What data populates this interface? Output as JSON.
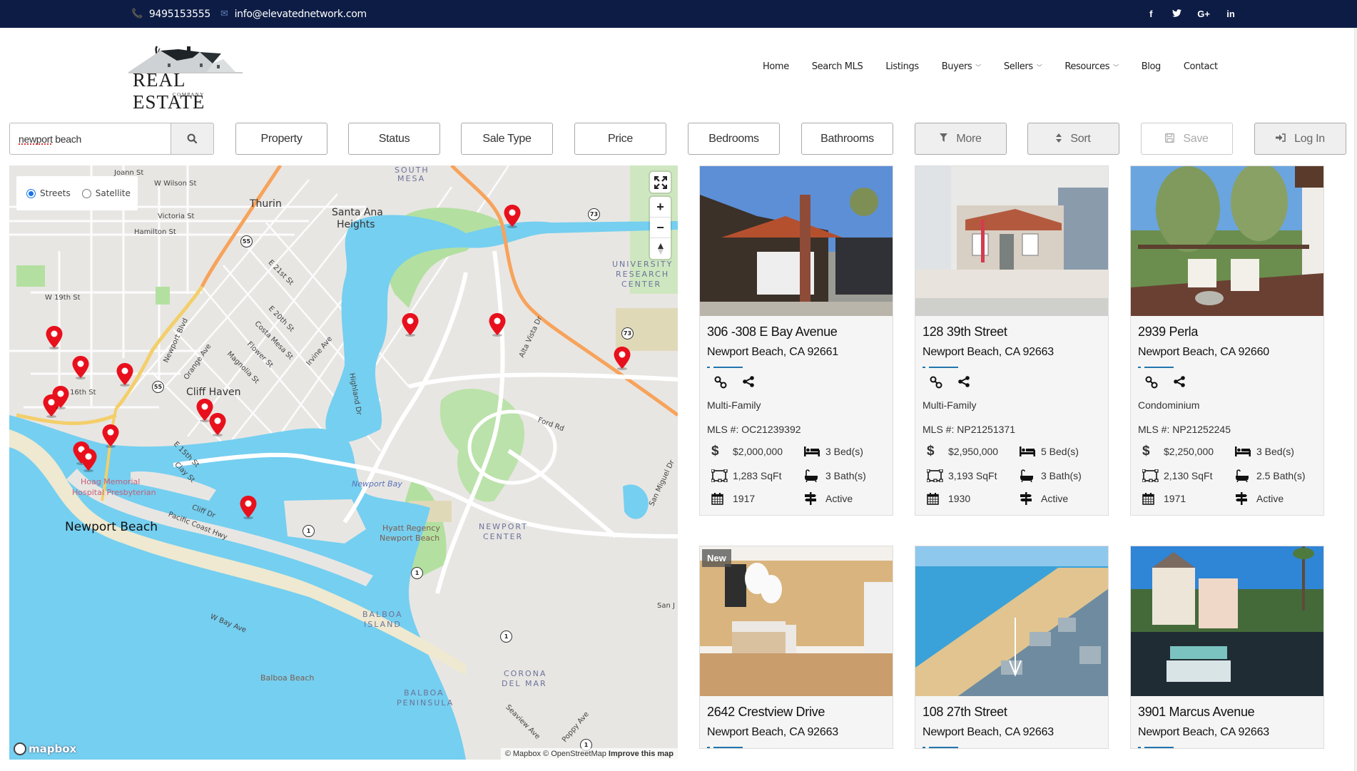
{
  "topbar": {
    "phone": "9495153555",
    "email": "info@elevatednetwork.com",
    "social": [
      {
        "name": "facebook-icon",
        "glyph": "f"
      },
      {
        "name": "twitter-icon",
        "glyph": "🐦"
      },
      {
        "name": "google-plus-icon",
        "glyph": "G+"
      },
      {
        "name": "linkedin-icon",
        "glyph": "in"
      }
    ]
  },
  "logo": {
    "brand": "REAL ESTATE",
    "sub": "COMPANY"
  },
  "nav": {
    "items": [
      {
        "label": "Home",
        "dropdown": false
      },
      {
        "label": "Search MLS",
        "dropdown": false
      },
      {
        "label": "Listings",
        "dropdown": false
      },
      {
        "label": "Buyers",
        "dropdown": true
      },
      {
        "label": "Sellers",
        "dropdown": true
      },
      {
        "label": "Resources",
        "dropdown": true
      },
      {
        "label": "Blog",
        "dropdown": false
      },
      {
        "label": "Contact",
        "dropdown": false
      }
    ]
  },
  "filters": {
    "search_value": "newport beach",
    "buttons": {
      "property": "Property",
      "status": "Status",
      "sale_type": "Sale Type",
      "price": "Price",
      "bedrooms": "Bedrooms",
      "bathrooms": "Bathrooms",
      "more": "More",
      "sort": "Sort",
      "save": "Save",
      "login": "Log In"
    }
  },
  "map": {
    "map_types": [
      {
        "label": "Streets",
        "selected": true
      },
      {
        "label": "Satellite",
        "selected": false
      }
    ],
    "labels": {
      "joann": "Joann St",
      "wilson": "W Wilson St",
      "thurin": "Thurin",
      "victoria": "Victoria St",
      "hamilton": "Hamilton St",
      "santa_ana": "Santa Ana",
      "heights": "Heights",
      "south": "SOUTH",
      "mesa": "MESA",
      "w19": "W 19th St",
      "w16": "W 16th St",
      "cliff_haven": "Cliff Haven",
      "newport_beach": "Newport Beach",
      "hoag1": "Hoag Memorial",
      "hoag2": "Hospital Presbyterian",
      "newport_bay": "Newport Bay",
      "hyatt1": "Hyatt Regency",
      "hyatt2": "Newport Beach",
      "newport_center1": "NEWPORT",
      "newport_center2": "CENTER",
      "univ1": "UNIVERSITY",
      "univ2": "RESEARCH",
      "univ3": "CENTER",
      "balboa_island1": "BALBOA",
      "balboa_island2": "ISLAND",
      "balboa_pen1": "BALBOA",
      "balboa_pen2": "PENINSULA",
      "corona1": "CORONA",
      "corona2": "DEL MAR",
      "balboa_beach": "Balboa Beach",
      "ford_rd": "Ford Rd",
      "pch": "Pacific Coast Hwy",
      "cliff_dr": "Cliff Dr",
      "w_bay": "W Bay Ave",
      "e15": "E 15th St",
      "clay": "Clay St",
      "e21": "E 21st St",
      "e20": "E 20th St",
      "irvine": "Irvine Ave",
      "alta_vista": "Alta Vista Dr",
      "san_miguel": "San Miguel Dr",
      "san_j": "San J",
      "newport_blvd": "Newport Blvd",
      "orange": "Orange Ave",
      "highland": "Highland Dr",
      "seaview": "Seaview Ave",
      "poppy": "Poppy Ave",
      "costa_mesa": "Costa Mesa St",
      "flower": "Flower St",
      "magnolia": "Magnolia St"
    },
    "shields": [
      "55",
      "55",
      "73",
      "73",
      "1",
      "1",
      "1",
      "1"
    ],
    "attribution": "© Mapbox © OpenStreetMap",
    "improve": "Improve this map",
    "mapbox_logo": "mapbox",
    "marker_count": 16
  },
  "listings": [
    {
      "address": "306 -308 E Bay Avenue",
      "city": "Newport Beach, CA 92661",
      "type": "Multi-Family",
      "mls": "MLS #: OC21239392",
      "price": "$2,000,000",
      "beds": "3 Bed(s)",
      "sqft": "1,283 SqFt",
      "baths": "3 Bath(s)",
      "year": "1917",
      "status": "Active",
      "badge": ""
    },
    {
      "address": "128 39th Street",
      "city": "Newport Beach, CA 92663",
      "type": "Multi-Family",
      "mls": "MLS #: NP21251371",
      "price": "$2,950,000",
      "beds": "5 Bed(s)",
      "sqft": "3,193 SqFt",
      "baths": "3 Bath(s)",
      "year": "1930",
      "status": "Active",
      "badge": ""
    },
    {
      "address": "2939 Perla",
      "city": "Newport Beach, CA 92660",
      "type": "Condominium",
      "mls": "MLS #: NP21252245",
      "price": "$2,250,000",
      "beds": "3 Bed(s)",
      "sqft": "2,130 SqFt",
      "baths": "2.5 Bath(s)",
      "year": "1971",
      "status": "Active",
      "badge": ""
    },
    {
      "address": "2642 Crestview Drive",
      "city": "Newport Beach, CA 92663",
      "badge": "New"
    },
    {
      "address": "108 27th Street",
      "city": "Newport Beach, CA 92663",
      "badge": ""
    },
    {
      "address": "3901 Marcus Avenue",
      "city": "Newport Beach, CA 92663",
      "badge": ""
    }
  ],
  "colors": {
    "topbar": "#0d1c45",
    "accent_rule": "#2176ae",
    "marker": "#e8101c",
    "water": "#75cff0",
    "park": "#b3e0a0",
    "highway": "#f7a35c"
  }
}
